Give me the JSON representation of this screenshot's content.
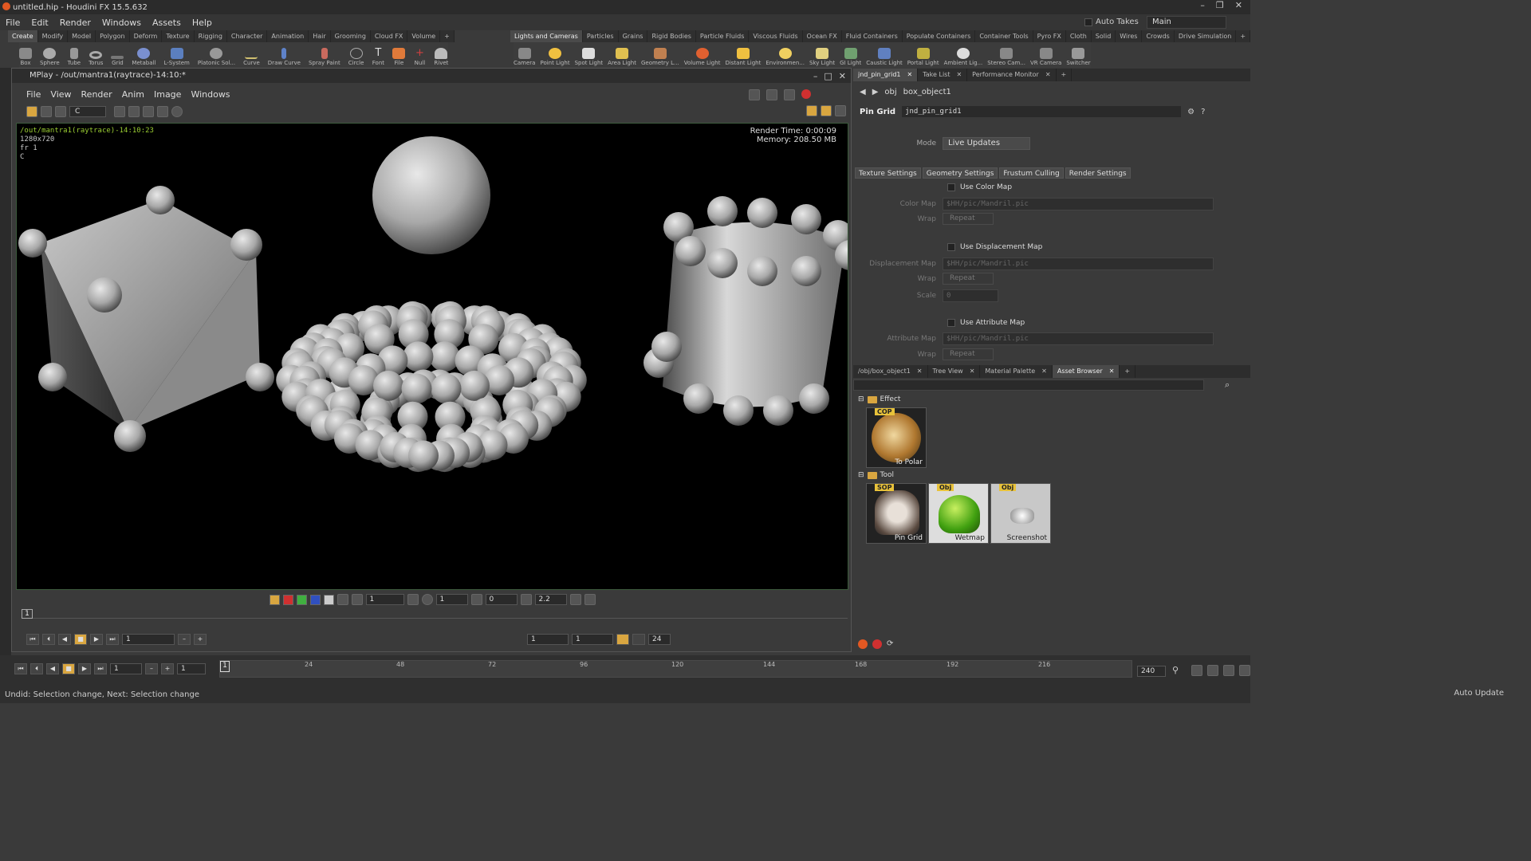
{
  "window": {
    "title": "untitled.hip - Houdini FX 15.5.632"
  },
  "menubar": [
    "File",
    "Edit",
    "Render",
    "Windows",
    "Assets",
    "Help"
  ],
  "top_right": {
    "auto_takes": "Auto Takes",
    "desktop": "Main"
  },
  "shelf_left_tabs": [
    "Create",
    "Modify",
    "Model",
    "Polygon",
    "Deform",
    "Texture",
    "Rigging",
    "Character",
    "Animation",
    "Hair",
    "Grooming",
    "Cloud FX",
    "Volume"
  ],
  "shelf_left_tools": [
    "Box",
    "Sphere",
    "Tube",
    "Torus",
    "Grid",
    "Metaball",
    "L-System",
    "Platonic Sol...",
    "Curve",
    "Draw Curve",
    "Spray Paint",
    "Circle",
    "Font",
    "File",
    "Null",
    "Rivet"
  ],
  "shelf_right_tabs": [
    "Lights and Cameras",
    "Particles",
    "Grains",
    "Rigid Bodies",
    "Particle Fluids",
    "Viscous Fluids",
    "Ocean FX",
    "Fluid Containers",
    "Populate Containers",
    "Container Tools",
    "Pyro FX",
    "Cloth",
    "Solid",
    "Wires",
    "Crowds",
    "Drive Simulation"
  ],
  "shelf_right_tools": [
    "Camera",
    "Point Light",
    "Spot Light",
    "Area Light",
    "Geometry L...",
    "Volume Light",
    "Distant Light",
    "Environmen...",
    "Sky Light",
    "GI Light",
    "Caustic Light",
    "Portal Light",
    "Ambient Lig...",
    "Stereo Cam...",
    "VR Camera",
    "Switcher"
  ],
  "mplay": {
    "title": "MPlay - /out/mantra1(raytrace)-14:10:*",
    "menu": [
      "File",
      "View",
      "Render",
      "Anim",
      "Image",
      "Windows"
    ],
    "channel": "C",
    "overlay": {
      "path": "/out/mantra1(raytrace)-14:10:23",
      "resolution": "1280x720",
      "frame": "fr 1",
      "channel": "C",
      "render_time": "Render Time: 0:00:09",
      "memory": "Memory:   208.50 MB"
    },
    "bottom": {
      "exposure": "1",
      "gamma_mult": "1",
      "offset": "0",
      "gamma": "2.2"
    },
    "frame_marker": "1",
    "play": {
      "frame": "1",
      "start": "1",
      "end": "1",
      "fps": "24"
    }
  },
  "param_tabs_top": [
    {
      "label": "jnd_pin_grid1",
      "active": true
    },
    {
      "label": "Take List",
      "active": false
    },
    {
      "label": "Performance Monitor",
      "active": false
    }
  ],
  "pathbar": {
    "root": "obj",
    "node": "box_object1"
  },
  "node": {
    "type": "Pin Grid",
    "name": "jnd_pin_grid1"
  },
  "params": {
    "mode_label": "Mode",
    "mode_value": "Live Updates",
    "tabs": [
      "Texture Settings",
      "Geometry Settings",
      "Frustum Culling",
      "Render Settings"
    ],
    "use_color_map": "Use Color Map",
    "color_map_label": "Color Map",
    "color_map_value": "$HH/pic/Mandril.pic",
    "wrap_label": "Wrap",
    "wrap_value": "Repeat",
    "use_disp_map": "Use Displacement Map",
    "disp_map_label": "Displacement Map",
    "disp_map_value": "$HH/pic/Mandril.pic",
    "scale_label": "Scale",
    "scale_value": "0",
    "use_attr_map": "Use Attribute Map",
    "attr_map_label": "Attribute Map",
    "attr_map_value": "$HH/pic/Mandril.pic"
  },
  "lower_tabs": [
    {
      "label": "/obj/box_object1",
      "active": false
    },
    {
      "label": "Tree View",
      "active": false
    },
    {
      "label": "Material Palette",
      "active": false
    },
    {
      "label": "Asset Browser",
      "active": true
    }
  ],
  "assets": {
    "effect_folder": "Effect",
    "tool_folder": "Tool",
    "effect_items": [
      {
        "badge": "COP",
        "name": "To Polar"
      }
    ],
    "tool_items": [
      {
        "badge": "SOP",
        "name": "Pin Grid"
      },
      {
        "badge": "Obj",
        "name": "Wetmap"
      },
      {
        "badge": "Obj",
        "name": "Screenshot"
      }
    ]
  },
  "timeline": {
    "frame": "1",
    "start": "1",
    "current": "1",
    "end": "240",
    "ticks": [
      "24",
      "48",
      "72",
      "96",
      "120",
      "144",
      "168",
      "192",
      "216"
    ]
  },
  "status": {
    "message": "Undid: Selection change, Next: Selection change",
    "auto_update": "Auto Update"
  }
}
